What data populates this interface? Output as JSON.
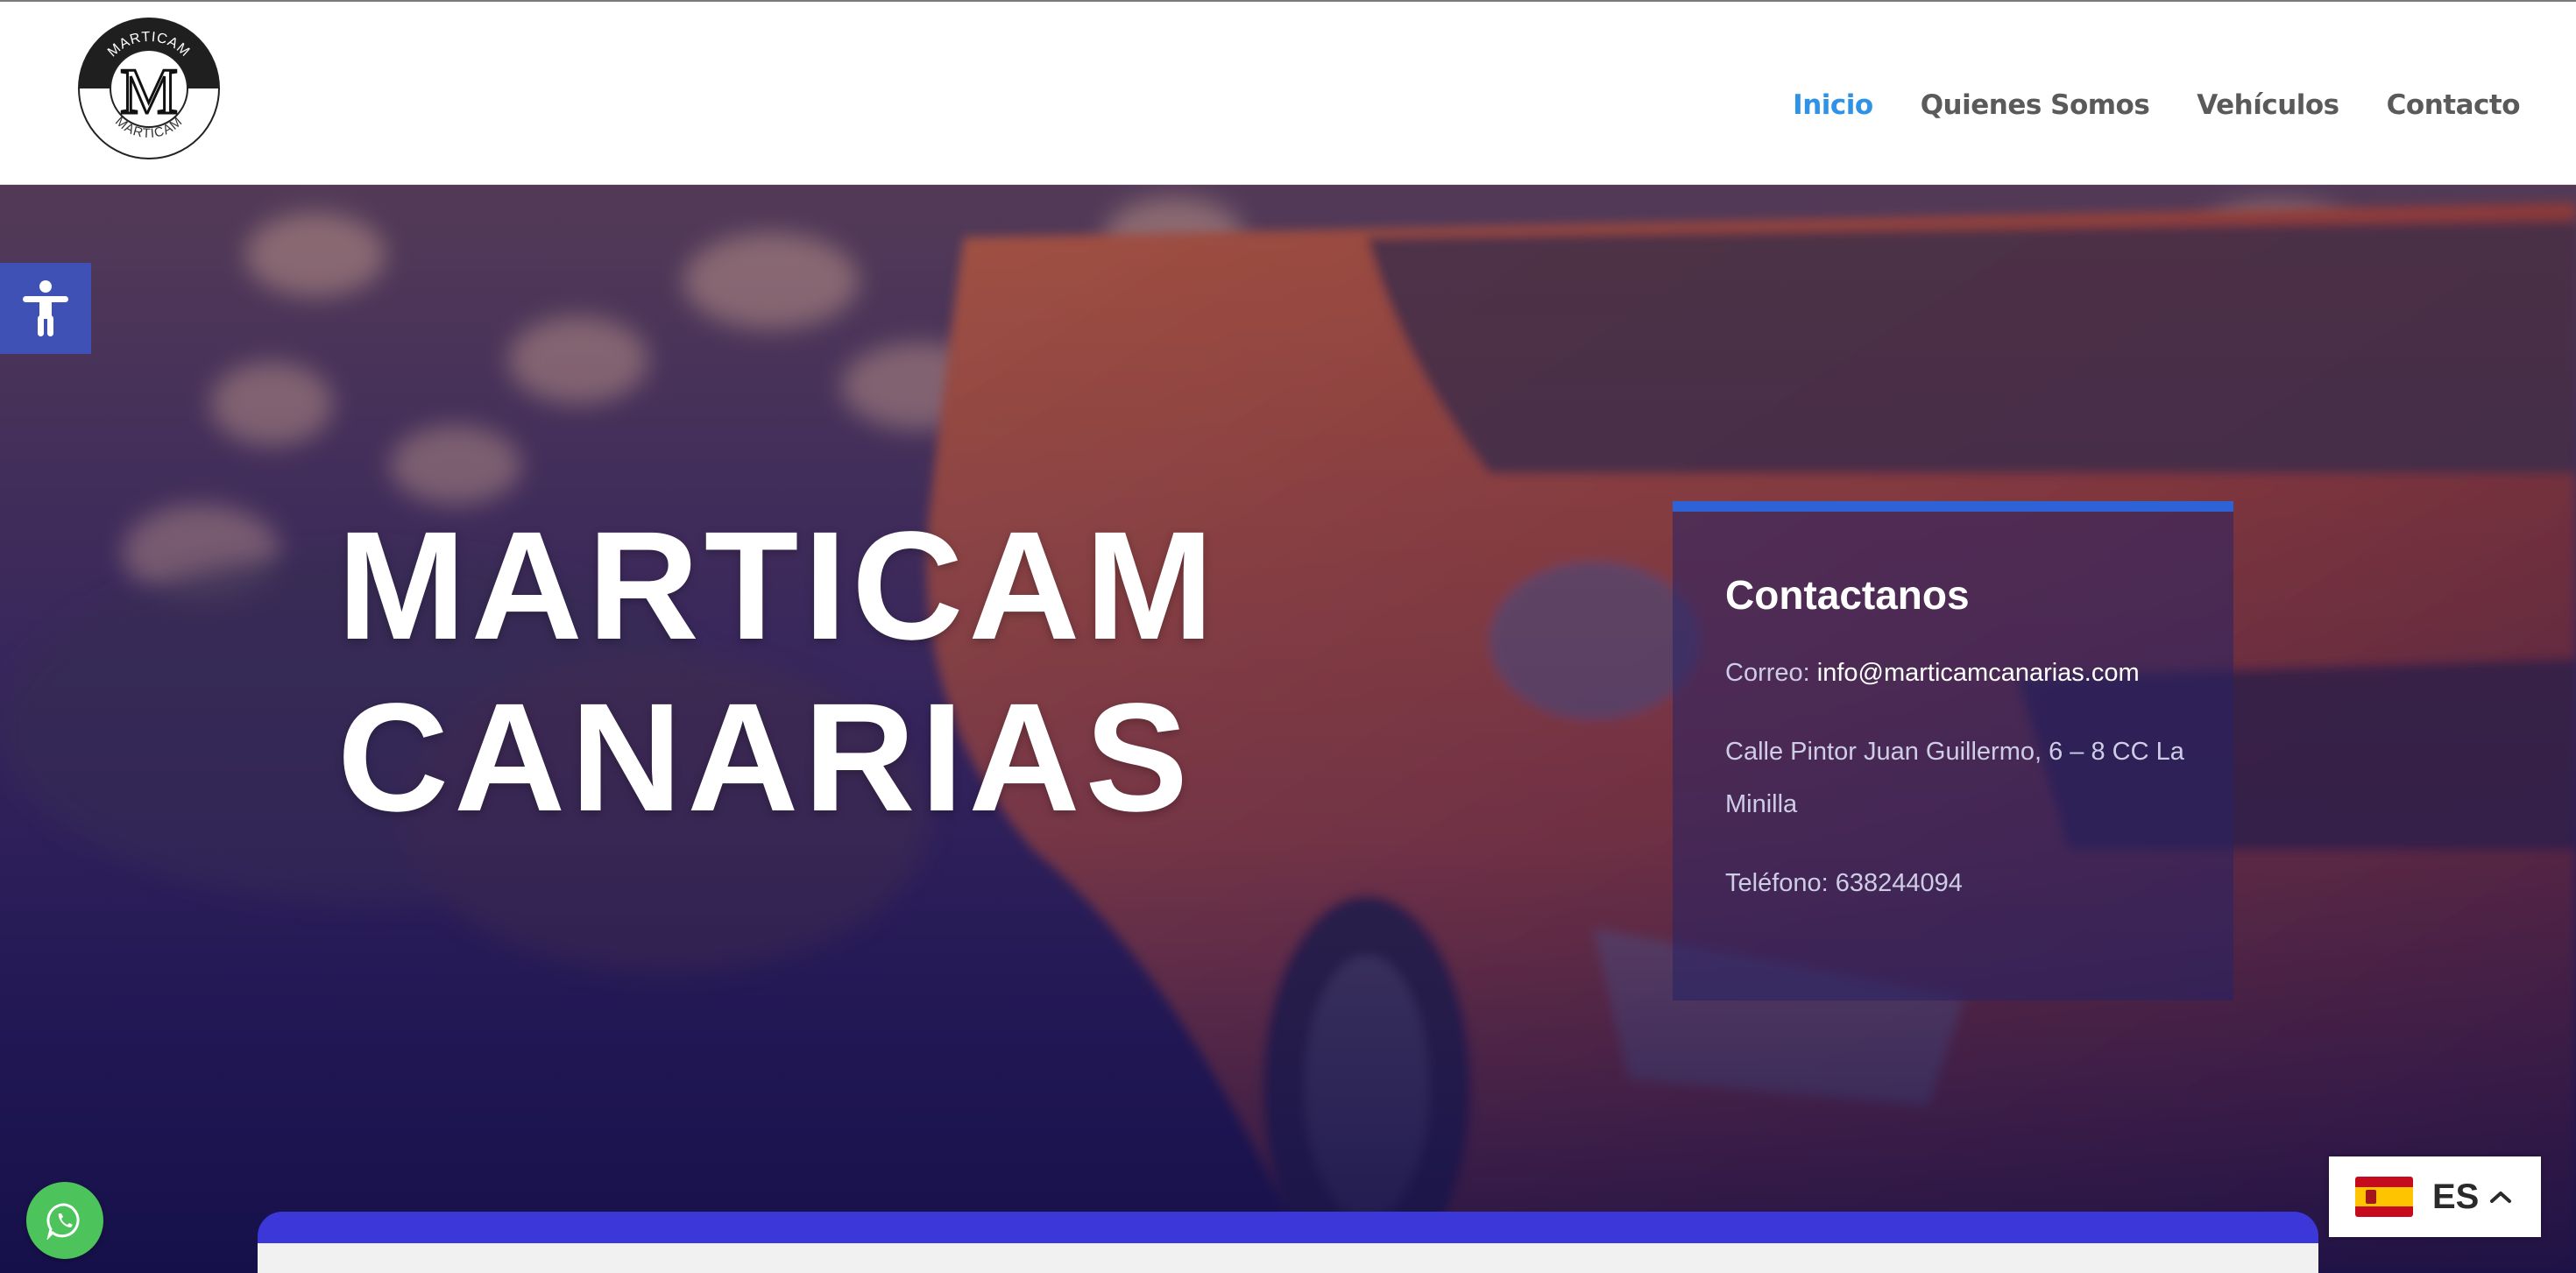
{
  "header": {
    "logo": {
      "text_top": "MARTICAM",
      "text_bottom": "MARTICAM",
      "letter": "M"
    },
    "nav": [
      {
        "label": "Inicio",
        "active": true
      },
      {
        "label": "Quienes Somos",
        "active": false
      },
      {
        "label": "Vehículos",
        "active": false
      },
      {
        "label": "Contacto",
        "active": false
      }
    ],
    "active_color": "#2e93e6"
  },
  "hero": {
    "title_line1": "MARTICAM",
    "title_line2": "CANARIAS"
  },
  "contact": {
    "heading": "Contactanos",
    "email_label": "Correo: ",
    "email": "info@marticamcanarias.com",
    "address": "Calle Pintor Juan Guillermo, 6 – 8 CC La Minilla",
    "phone": "Teléfono: 638244094",
    "accent_color": "#2d63d6"
  },
  "widgets": {
    "accessibility_icon": "accessibility-person-icon",
    "whatsapp_icon": "whatsapp-icon",
    "language": {
      "code": "ES",
      "flag": "spain-flag-icon"
    }
  }
}
